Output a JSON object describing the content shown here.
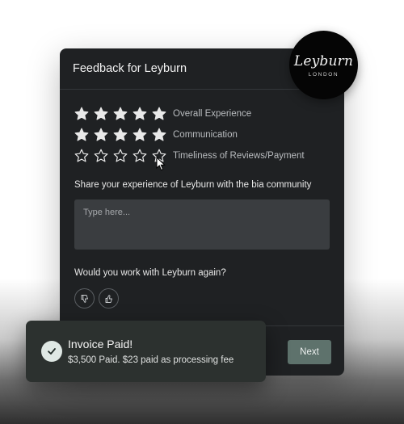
{
  "card": {
    "title": "Feedback for Leyburn"
  },
  "logo": {
    "name": "Leyburn",
    "subtitle": "LONDON"
  },
  "ratings": [
    {
      "label": "Overall Experience",
      "stars": 5,
      "max": 5
    },
    {
      "label": "Communication",
      "stars": 5,
      "max": 5
    },
    {
      "label": "Timeliness of Reviews/Payment",
      "stars": 0,
      "max": 5
    }
  ],
  "feedback": {
    "prompt": "Share your experience of Leyburn with the bia community",
    "placeholder": "Type here..."
  },
  "recommend": {
    "question": "Would you work with Leyburn again?",
    "thumbs_down_icon": "thumbs-down-icon",
    "thumbs_up_icon": "thumbs-up-icon"
  },
  "footer": {
    "next_label": "Next"
  },
  "toast": {
    "title": "Invoice Paid!",
    "detail": "$3,500  Paid. $23 paid as processing fee",
    "icon": "check-icon"
  },
  "colors": {
    "card_bg": "#1f2123",
    "accent": "#5e726c",
    "toast_bg": "#2c312f"
  }
}
